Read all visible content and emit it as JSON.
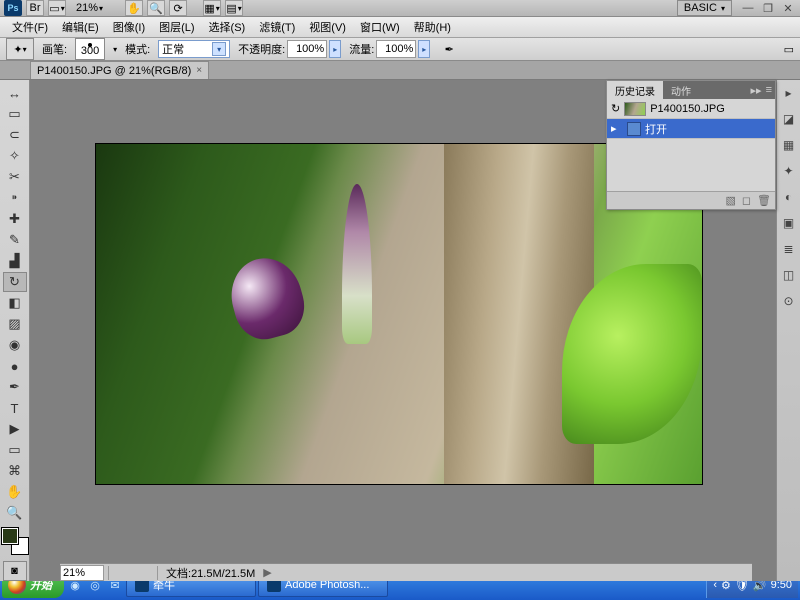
{
  "title_bar": {
    "workspace": "BASIC",
    "zoom_dropdown": "21%"
  },
  "menu": {
    "file": "文件(F)",
    "edit": "编辑(E)",
    "image": "图像(I)",
    "layer": "图层(L)",
    "select": "选择(S)",
    "filter": "滤镜(T)",
    "view": "视图(V)",
    "window": "窗口(W)",
    "help": "帮助(H)"
  },
  "options": {
    "brush_label": "画笔:",
    "brush_size": "300",
    "mode_label": "模式:",
    "mode_value": "正常",
    "opacity_label": "不透明度:",
    "opacity_value": "100%",
    "flow_label": "流量:",
    "flow_value": "100%"
  },
  "doc_tab": {
    "title": "P1400150.JPG @ 21%(RGB/8)"
  },
  "history": {
    "tab_history": "历史记录",
    "tab_actions": "动作",
    "snapshot": "P1400150.JPG",
    "step_open": "打开"
  },
  "status": {
    "zoom": "21%",
    "doc_size_label": "文档:",
    "doc_size": "21.5M/21.5M"
  },
  "taskbar": {
    "start": "开始",
    "tasks": [
      {
        "label": "牵牛"
      },
      {
        "label": "Adobe Photosh..."
      }
    ],
    "clock": "9:50"
  }
}
